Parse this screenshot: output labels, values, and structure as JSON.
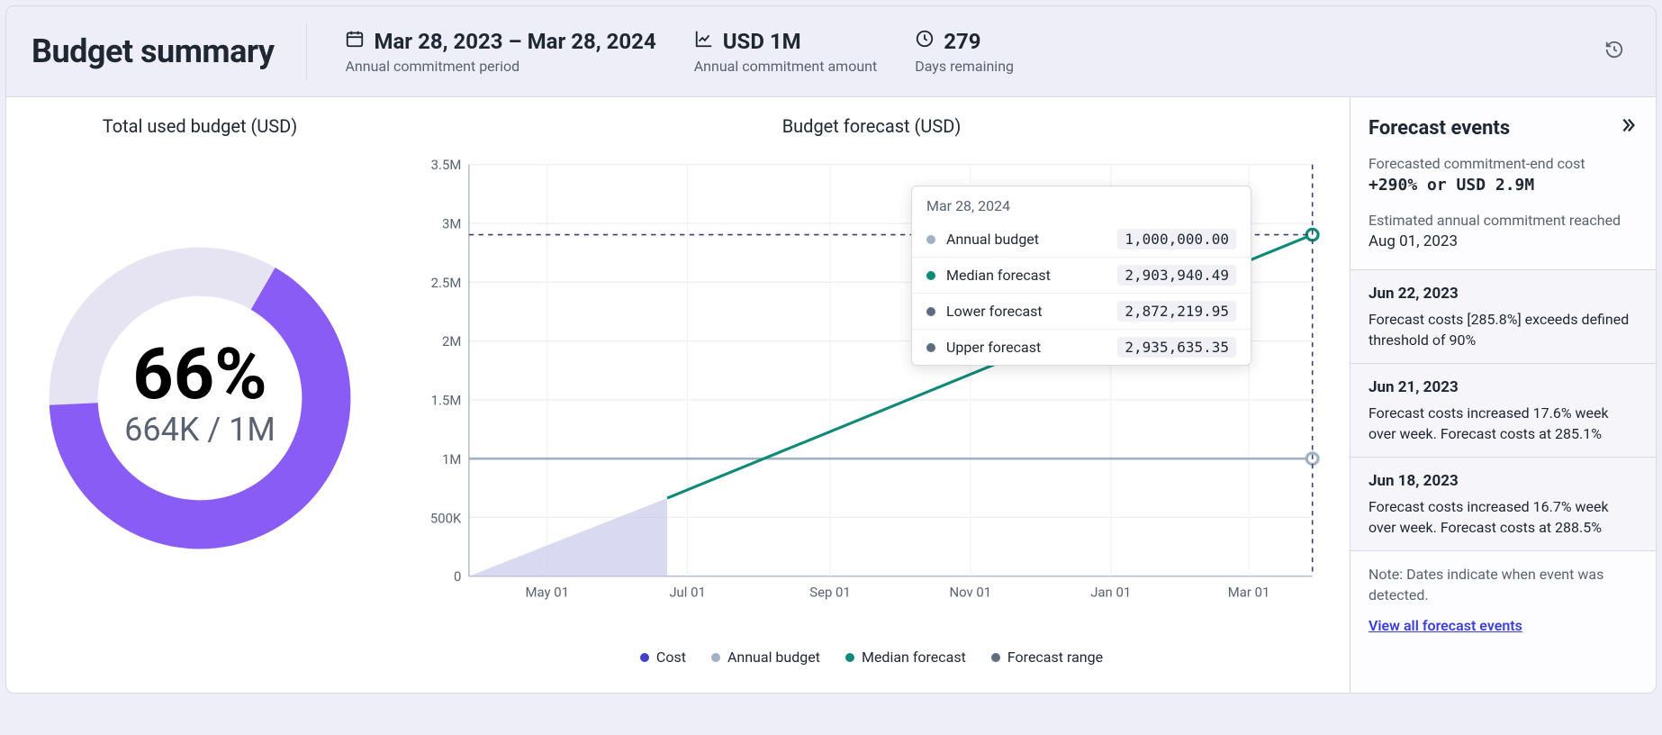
{
  "header": {
    "title": "Budget summary",
    "period": {
      "value": "Mar 28, 2023 – Mar 28, 2024",
      "label": "Annual commitment period"
    },
    "amount": {
      "value": "USD 1M",
      "label": "Annual commitment amount"
    },
    "days": {
      "value": "279",
      "label": "Days remaining"
    }
  },
  "donut": {
    "title": "Total used budget (USD)",
    "percent_text": "66%",
    "sub_text": "664K / 1M",
    "percent": 66
  },
  "chart": {
    "title": "Budget forecast (USD)"
  },
  "chart_data": {
    "type": "line",
    "title": "Budget forecast (USD)",
    "xlabel": "",
    "ylabel": "",
    "ylim": [
      0,
      3500000
    ],
    "y_ticks": [
      0,
      500000,
      1000000,
      1500000,
      2000000,
      2500000,
      3000000,
      3500000
    ],
    "y_tick_labels": [
      "0",
      "500K",
      "1M",
      "1.5M",
      "2M",
      "2.5M",
      "3M",
      "3.5M"
    ],
    "x_categories": [
      "May 01",
      "Jul 01",
      "Sep 01",
      "Nov 01",
      "Jan 01",
      "Mar 01"
    ],
    "x_range": [
      "2023-03-28",
      "2024-03-28"
    ],
    "series": [
      {
        "name": "Cost",
        "color": "#4141c9",
        "type": "area",
        "points": [
          {
            "x": "2023-03-28",
            "y": 0
          },
          {
            "x": "2023-06-22",
            "y": 664000
          }
        ]
      },
      {
        "name": "Annual budget",
        "color": "#a1b1c4",
        "type": "line-flat",
        "points": [
          {
            "x": "2023-03-28",
            "y": 1000000
          },
          {
            "x": "2024-03-28",
            "y": 1000000
          }
        ],
        "end_marker": true
      },
      {
        "name": "Median forecast",
        "color": "#0f8a78",
        "type": "line",
        "points": [
          {
            "x": "2023-06-22",
            "y": 664000
          },
          {
            "x": "2024-03-28",
            "y": 2903940.49
          }
        ],
        "end_marker": true,
        "dashed_ref_y": 2903940.49
      },
      {
        "name": "Forecast range",
        "color": "#5f6b82",
        "type": "band",
        "lower": [
          {
            "x": "2023-06-22",
            "y": 664000
          },
          {
            "x": "2024-03-28",
            "y": 2872219.95
          }
        ],
        "upper": [
          {
            "x": "2023-06-22",
            "y": 664000
          },
          {
            "x": "2024-03-28",
            "y": 2935635.35
          }
        ]
      }
    ],
    "vertical_marker": "2024-03-28"
  },
  "legend": [
    {
      "label": "Cost",
      "color": "#4141c9"
    },
    {
      "label": "Annual budget",
      "color": "#a1b1c4"
    },
    {
      "label": "Median forecast",
      "color": "#0f8a78"
    },
    {
      "label": "Forecast range",
      "color": "#5f6b82"
    }
  ],
  "tooltip": {
    "date": "Mar 28, 2024",
    "rows": [
      {
        "color": "#a1b1c4",
        "label": "Annual budget",
        "value": "1,000,000.00"
      },
      {
        "color": "#0f8a78",
        "label": "Median forecast",
        "value": "2,903,940.49"
      },
      {
        "color": "#5f6b82",
        "label": "Lower forecast",
        "value": "2,872,219.95"
      },
      {
        "color": "#5f6b82",
        "label": "Upper forecast",
        "value": "2,935,635.35"
      }
    ]
  },
  "events": {
    "title": "Forecast events",
    "summary": {
      "cost_label": "Forecasted commitment-end cost",
      "cost_value": "+290% or USD 2.9M",
      "reached_label": "Estimated annual commitment reached",
      "reached_value": "Aug 01, 2023"
    },
    "items": [
      {
        "date": "Jun 22, 2023",
        "text": "Forecast costs [285.8%] exceeds defined threshold of 90%"
      },
      {
        "date": "Jun 21, 2023",
        "text": "Forecast costs increased 17.6% week over week. Forecast costs at 285.1%"
      },
      {
        "date": "Jun 18, 2023",
        "text": "Forecast costs increased 16.7% week over week. Forecast costs at 288.5%"
      }
    ],
    "note": "Note: Dates indicate when event was detected.",
    "link": "View all forecast events"
  }
}
